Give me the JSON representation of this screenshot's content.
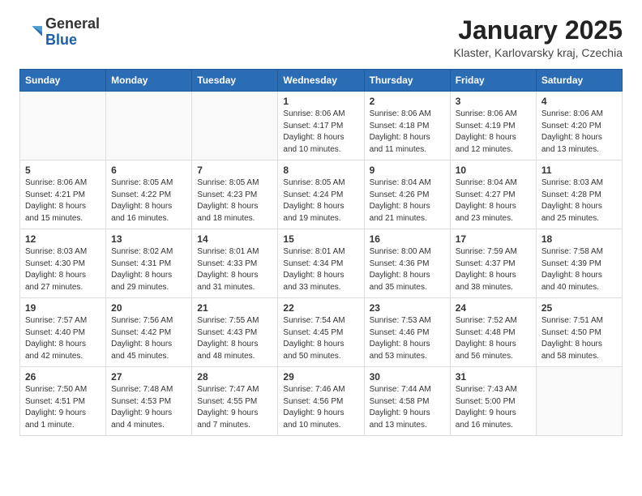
{
  "logo": {
    "general": "General",
    "blue": "Blue"
  },
  "title": "January 2025",
  "subtitle": "Klaster, Karlovarsky kraj, Czechia",
  "days_of_week": [
    "Sunday",
    "Monday",
    "Tuesday",
    "Wednesday",
    "Thursday",
    "Friday",
    "Saturday"
  ],
  "weeks": [
    [
      {
        "day": "",
        "info": ""
      },
      {
        "day": "",
        "info": ""
      },
      {
        "day": "",
        "info": ""
      },
      {
        "day": "1",
        "info": "Sunrise: 8:06 AM\nSunset: 4:17 PM\nDaylight: 8 hours\nand 10 minutes."
      },
      {
        "day": "2",
        "info": "Sunrise: 8:06 AM\nSunset: 4:18 PM\nDaylight: 8 hours\nand 11 minutes."
      },
      {
        "day": "3",
        "info": "Sunrise: 8:06 AM\nSunset: 4:19 PM\nDaylight: 8 hours\nand 12 minutes."
      },
      {
        "day": "4",
        "info": "Sunrise: 8:06 AM\nSunset: 4:20 PM\nDaylight: 8 hours\nand 13 minutes."
      }
    ],
    [
      {
        "day": "5",
        "info": "Sunrise: 8:06 AM\nSunset: 4:21 PM\nDaylight: 8 hours\nand 15 minutes."
      },
      {
        "day": "6",
        "info": "Sunrise: 8:05 AM\nSunset: 4:22 PM\nDaylight: 8 hours\nand 16 minutes."
      },
      {
        "day": "7",
        "info": "Sunrise: 8:05 AM\nSunset: 4:23 PM\nDaylight: 8 hours\nand 18 minutes."
      },
      {
        "day": "8",
        "info": "Sunrise: 8:05 AM\nSunset: 4:24 PM\nDaylight: 8 hours\nand 19 minutes."
      },
      {
        "day": "9",
        "info": "Sunrise: 8:04 AM\nSunset: 4:26 PM\nDaylight: 8 hours\nand 21 minutes."
      },
      {
        "day": "10",
        "info": "Sunrise: 8:04 AM\nSunset: 4:27 PM\nDaylight: 8 hours\nand 23 minutes."
      },
      {
        "day": "11",
        "info": "Sunrise: 8:03 AM\nSunset: 4:28 PM\nDaylight: 8 hours\nand 25 minutes."
      }
    ],
    [
      {
        "day": "12",
        "info": "Sunrise: 8:03 AM\nSunset: 4:30 PM\nDaylight: 8 hours\nand 27 minutes."
      },
      {
        "day": "13",
        "info": "Sunrise: 8:02 AM\nSunset: 4:31 PM\nDaylight: 8 hours\nand 29 minutes."
      },
      {
        "day": "14",
        "info": "Sunrise: 8:01 AM\nSunset: 4:33 PM\nDaylight: 8 hours\nand 31 minutes."
      },
      {
        "day": "15",
        "info": "Sunrise: 8:01 AM\nSunset: 4:34 PM\nDaylight: 8 hours\nand 33 minutes."
      },
      {
        "day": "16",
        "info": "Sunrise: 8:00 AM\nSunset: 4:36 PM\nDaylight: 8 hours\nand 35 minutes."
      },
      {
        "day": "17",
        "info": "Sunrise: 7:59 AM\nSunset: 4:37 PM\nDaylight: 8 hours\nand 38 minutes."
      },
      {
        "day": "18",
        "info": "Sunrise: 7:58 AM\nSunset: 4:39 PM\nDaylight: 8 hours\nand 40 minutes."
      }
    ],
    [
      {
        "day": "19",
        "info": "Sunrise: 7:57 AM\nSunset: 4:40 PM\nDaylight: 8 hours\nand 42 minutes."
      },
      {
        "day": "20",
        "info": "Sunrise: 7:56 AM\nSunset: 4:42 PM\nDaylight: 8 hours\nand 45 minutes."
      },
      {
        "day": "21",
        "info": "Sunrise: 7:55 AM\nSunset: 4:43 PM\nDaylight: 8 hours\nand 48 minutes."
      },
      {
        "day": "22",
        "info": "Sunrise: 7:54 AM\nSunset: 4:45 PM\nDaylight: 8 hours\nand 50 minutes."
      },
      {
        "day": "23",
        "info": "Sunrise: 7:53 AM\nSunset: 4:46 PM\nDaylight: 8 hours\nand 53 minutes."
      },
      {
        "day": "24",
        "info": "Sunrise: 7:52 AM\nSunset: 4:48 PM\nDaylight: 8 hours\nand 56 minutes."
      },
      {
        "day": "25",
        "info": "Sunrise: 7:51 AM\nSunset: 4:50 PM\nDaylight: 8 hours\nand 58 minutes."
      }
    ],
    [
      {
        "day": "26",
        "info": "Sunrise: 7:50 AM\nSunset: 4:51 PM\nDaylight: 9 hours\nand 1 minute."
      },
      {
        "day": "27",
        "info": "Sunrise: 7:48 AM\nSunset: 4:53 PM\nDaylight: 9 hours\nand 4 minutes."
      },
      {
        "day": "28",
        "info": "Sunrise: 7:47 AM\nSunset: 4:55 PM\nDaylight: 9 hours\nand 7 minutes."
      },
      {
        "day": "29",
        "info": "Sunrise: 7:46 AM\nSunset: 4:56 PM\nDaylight: 9 hours\nand 10 minutes."
      },
      {
        "day": "30",
        "info": "Sunrise: 7:44 AM\nSunset: 4:58 PM\nDaylight: 9 hours\nand 13 minutes."
      },
      {
        "day": "31",
        "info": "Sunrise: 7:43 AM\nSunset: 5:00 PM\nDaylight: 9 hours\nand 16 minutes."
      },
      {
        "day": "",
        "info": ""
      }
    ]
  ]
}
